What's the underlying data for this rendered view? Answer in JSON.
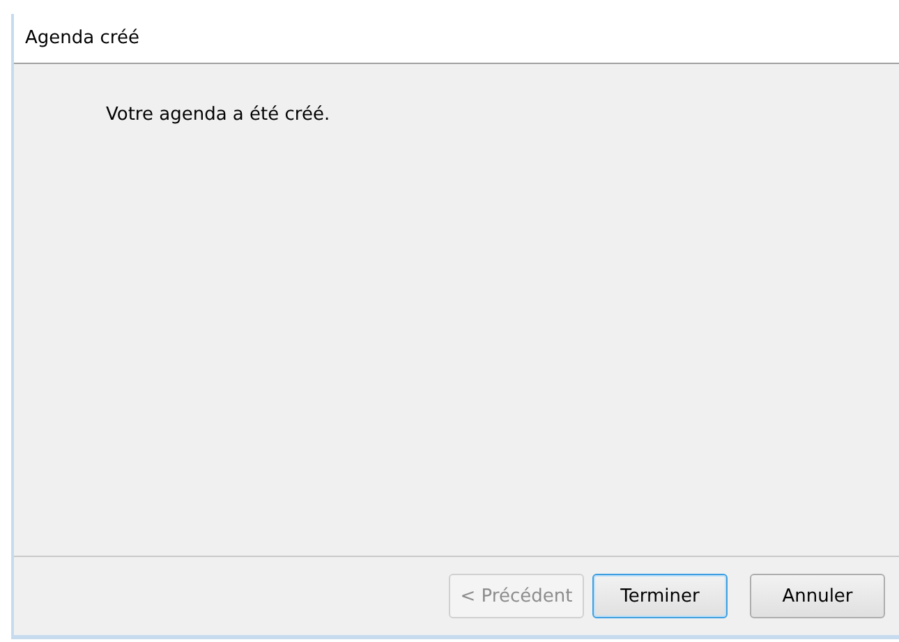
{
  "window": {
    "title": "Agenda créé"
  },
  "message": "Votre agenda a été créé.",
  "buttons": [
    {
      "label": "< Précédent",
      "disabled": true,
      "default": false
    },
    {
      "label": "Terminer",
      "disabled": false,
      "default": true
    },
    {
      "label": "Annuler",
      "disabled": false,
      "default": false
    }
  ]
}
